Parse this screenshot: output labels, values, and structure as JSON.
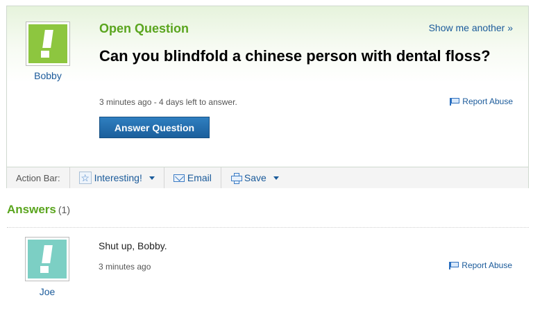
{
  "question": {
    "asker_name": "Bobby",
    "category_label": "Open Question",
    "show_another": "Show me another »",
    "title": "Can you blindfold a chinese person with dental floss?",
    "meta": "3 minutes ago - 4 days left to answer.",
    "report_label": "Report Abuse",
    "answer_button": "Answer Question",
    "avatar_color": "#8dc63f"
  },
  "action_bar": {
    "label": "Action Bar:",
    "interesting": "Interesting!",
    "email": "Email",
    "save": "Save"
  },
  "answers": {
    "heading": "Answers",
    "count": "(1)",
    "items": [
      {
        "author": "Joe",
        "text": "Shut up, Bobby.",
        "meta": "3 minutes ago",
        "report_label": "Report Abuse",
        "avatar_color": "#7ccfc4"
      }
    ]
  }
}
